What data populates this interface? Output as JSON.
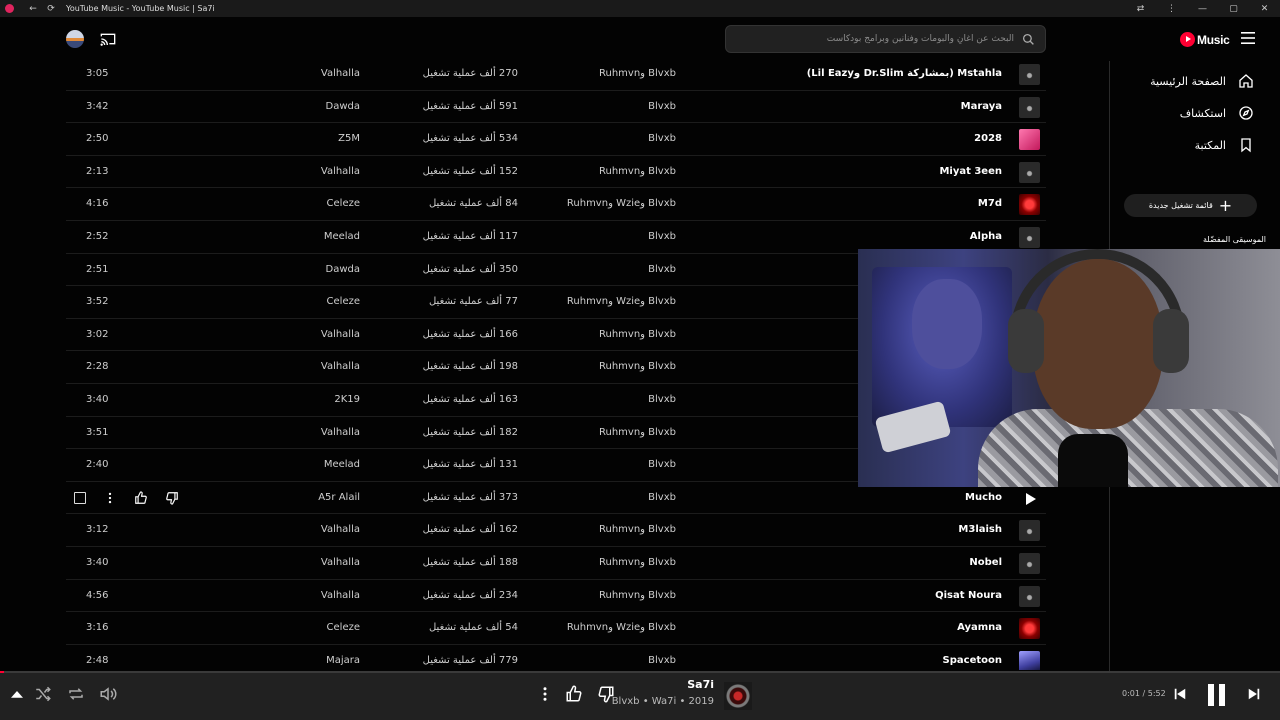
{
  "window": {
    "title": "YouTube Music - YouTube Music | Sa7i",
    "back_glyph": "←",
    "reload_glyph": "⟳"
  },
  "header": {
    "logo_text": "Music",
    "search_placeholder": "البحث عن أغانٍ وألبومات وفنانين وبرامج بودكاست"
  },
  "sidebar": {
    "items": [
      {
        "label": "الصفحة الرئيسية",
        "icon": "home-icon"
      },
      {
        "label": "استكشاف",
        "icon": "explore-icon"
      },
      {
        "label": "المكتبة",
        "icon": "library-icon"
      }
    ],
    "new_playlist_label": "قائمة تشغيل جديدة",
    "favorites_label": "الموسيقى المفضّلة"
  },
  "tracks": [
    {
      "title": "Mstahla (بمشاركة Dr.Slim وLil Eazy)",
      "artist": "Blvxb وRuhmvn",
      "plays": "270 ألف عملية تشغيل",
      "album": "Valhalla",
      "duration": "3:05",
      "art": "art-a"
    },
    {
      "title": "Maraya",
      "artist": "Blvxb",
      "plays": "591 ألف عملية تشغيل",
      "album": "Dawda",
      "duration": "3:42",
      "art": "art-a"
    },
    {
      "title": "2028",
      "artist": "Blvxb",
      "plays": "534 ألف عملية تشغيل",
      "album": "Z5M",
      "duration": "2:50",
      "art": "art-b"
    },
    {
      "title": "Miyat 3een",
      "artist": "Blvxb وRuhmvn",
      "plays": "152 ألف عملية تشغيل",
      "album": "Valhalla",
      "duration": "2:13",
      "art": "art-a"
    },
    {
      "title": "M7d",
      "artist": "Blvxb وWzie وRuhmvn",
      "plays": "84 ألف عملية تشغيل",
      "album": "Celeze",
      "duration": "4:16",
      "art": "art-c"
    },
    {
      "title": "Alpha",
      "artist": "Blvxb",
      "plays": "117 ألف عملية تشغيل",
      "album": "Meelad",
      "duration": "2:52",
      "art": "art-a"
    },
    {
      "title": "",
      "artist": "Blvxb",
      "plays": "350 ألف عملية تشغيل",
      "album": "Dawda",
      "duration": "2:51",
      "art": "art-a"
    },
    {
      "title": "",
      "artist": "Blvxb وWzie وRuhmvn",
      "plays": "77 ألف عملية تشغيل",
      "album": "Celeze",
      "duration": "3:52",
      "art": "art-a"
    },
    {
      "title": "",
      "artist": "Blvxb وRuhmvn",
      "plays": "166 ألف عملية تشغيل",
      "album": "Valhalla",
      "duration": "3:02",
      "art": "art-a"
    },
    {
      "title": "",
      "artist": "Blvxb وRuhmvn",
      "plays": "198 ألف عملية تشغيل",
      "album": "Valhalla",
      "duration": "2:28",
      "art": "art-a"
    },
    {
      "title": "",
      "artist": "Blvxb",
      "plays": "163 ألف عملية تشغيل",
      "album": "2K19",
      "duration": "3:40",
      "art": "art-a"
    },
    {
      "title": "",
      "artist": "Blvxb وRuhmvn",
      "plays": "182 ألف عملية تشغيل",
      "album": "Valhalla",
      "duration": "3:51",
      "art": "art-a"
    },
    {
      "title": "",
      "artist": "Blvxb",
      "plays": "131 ألف عملية تشغيل",
      "album": "Meelad",
      "duration": "2:40",
      "art": "art-a"
    },
    {
      "title": "Mucho",
      "artist": "Blvxb",
      "plays": "373 ألف عملية تشغيل",
      "album": "A5r Alail",
      "duration": "",
      "art": "art-play",
      "hovered": true
    },
    {
      "title": "M3laish",
      "artist": "Blvxb وRuhmvn",
      "plays": "162 ألف عملية تشغيل",
      "album": "Valhalla",
      "duration": "3:12",
      "art": "art-a"
    },
    {
      "title": "Nobel",
      "artist": "Blvxb وRuhmvn",
      "plays": "188 ألف عملية تشغيل",
      "album": "Valhalla",
      "duration": "3:40",
      "art": "art-a"
    },
    {
      "title": "Qisat Noura",
      "artist": "Blvxb وRuhmvn",
      "plays": "234 ألف عملية تشغيل",
      "album": "Valhalla",
      "duration": "4:56",
      "art": "art-a"
    },
    {
      "title": "Ayamna",
      "artist": "Blvxb وWzie وRuhmvn",
      "plays": "54 ألف عملية تشغيل",
      "album": "Celeze",
      "duration": "3:16",
      "art": "art-c"
    },
    {
      "title": "Spacetoon",
      "artist": "Blvxb",
      "plays": "779 ألف عملية تشغيل",
      "album": "Majara",
      "duration": "2:48",
      "art": "art-d"
    }
  ],
  "player": {
    "title": "Sa7i",
    "subtitle": "Blvxb • Wa7i • 2019",
    "time": "0:01 / 5:52",
    "progress_fraction": 0.003
  },
  "colors": {
    "accent": "#ff0033",
    "background": "#030303",
    "player_bg": "#212121"
  }
}
